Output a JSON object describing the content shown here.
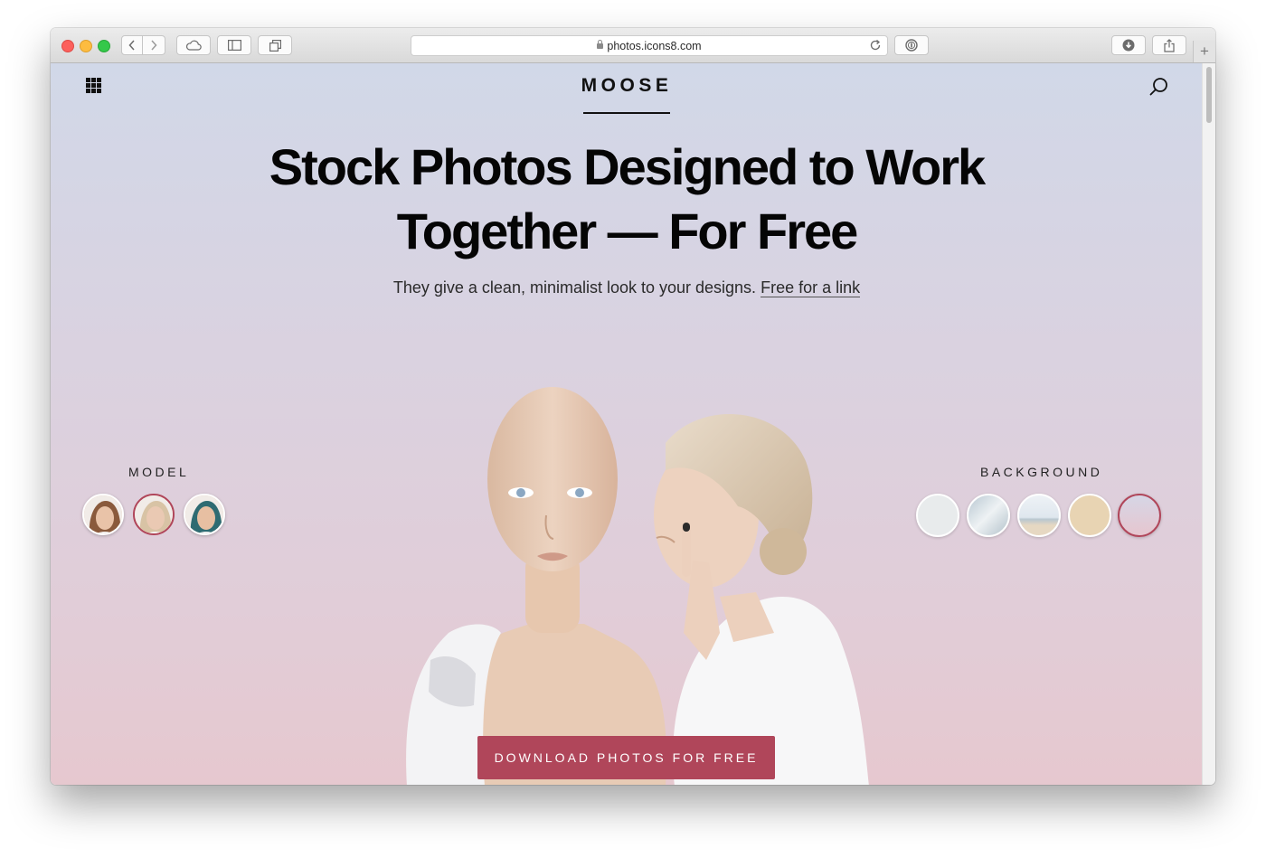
{
  "browser": {
    "url": "photos.icons8.com"
  },
  "site": {
    "brand": "MOOSE",
    "headline_line1": "Stock Photos Designed to Work",
    "headline_line2": "Together — For Free",
    "subline": "They give a clean, minimalist look to your designs.",
    "subline_link": "Free for a link",
    "model_label": "MODEL",
    "background_label": "BACKGROUND",
    "cta": "DOWNLOAD PHOTOS FOR FREE"
  },
  "models": [
    {
      "name": "model-1",
      "selected": false,
      "hair": "#8a5a3c",
      "skin": "#e9c3a8"
    },
    {
      "name": "model-2",
      "selected": true,
      "hair": "#d8c3a5",
      "skin": "#eac9b3"
    },
    {
      "name": "model-3",
      "selected": false,
      "hair": "#2e6b72",
      "skin": "#e7bfa2"
    }
  ],
  "backgrounds": [
    {
      "name": "white-room",
      "selected": false,
      "color": "#e8ebec"
    },
    {
      "name": "sailboat",
      "selected": false,
      "color": "#c9d6dd"
    },
    {
      "name": "beach",
      "selected": false,
      "color": "#dfe5ea"
    },
    {
      "name": "beige",
      "selected": false,
      "color": "#e8d4b3"
    },
    {
      "name": "gradient-pink",
      "selected": true,
      "color": "#d9c9d8"
    }
  ],
  "colors": {
    "accent": "#b0465a",
    "text": "#050505"
  }
}
